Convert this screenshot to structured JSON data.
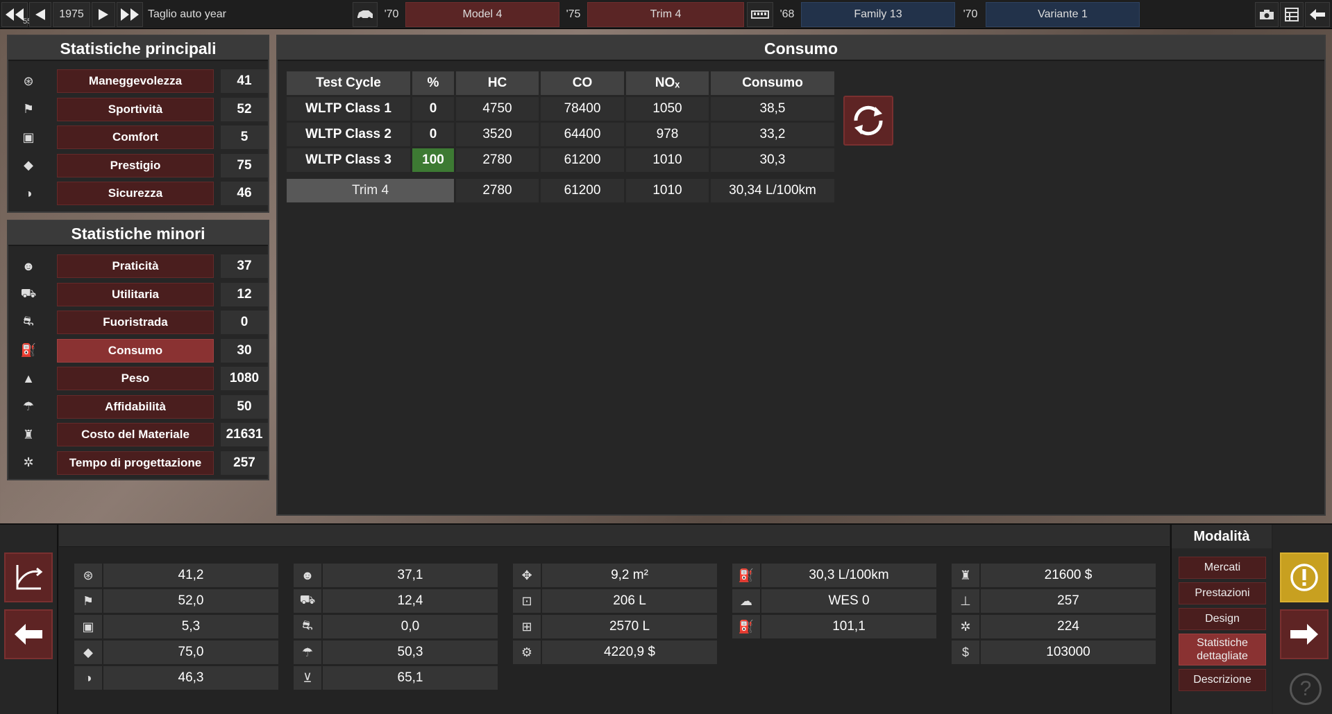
{
  "topbar": {
    "badge": "55",
    "year": "1975",
    "year_label": "Taglio auto year",
    "model_year": "'70",
    "model_name": "Model 4",
    "trim_year": "'75",
    "trim_name": "Trim 4",
    "engine_year": "'68",
    "family_name": "Family 13",
    "variant_year": "'70",
    "variant_name": "Variante 1"
  },
  "main_stats": {
    "title": "Statistiche principali",
    "items": [
      {
        "icon": "steering-wheel-icon",
        "label": "Maneggevolezza",
        "value": "41"
      },
      {
        "icon": "checkered-flag-icon",
        "label": "Sportività",
        "value": "52"
      },
      {
        "icon": "seat-icon",
        "label": "Comfort",
        "value": "5"
      },
      {
        "icon": "diamond-icon",
        "label": "Prestigio",
        "value": "75"
      },
      {
        "icon": "crash-test-icon",
        "label": "Sicurezza",
        "value": "46"
      }
    ]
  },
  "minor_stats": {
    "title": "Statistiche minori",
    "items": [
      {
        "icon": "passengers-icon",
        "label": "Praticità",
        "value": "37"
      },
      {
        "icon": "truck-icon",
        "label": "Utilitaria",
        "value": "12"
      },
      {
        "icon": "offroad-icon",
        "label": "Fuoristrada",
        "value": "0"
      },
      {
        "icon": "fuel-can-icon",
        "label": "Consumo",
        "value": "30"
      },
      {
        "icon": "weight-icon",
        "label": "Peso",
        "value": "1080"
      },
      {
        "icon": "reliability-icon",
        "label": "Affidabilità",
        "value": "50"
      },
      {
        "icon": "engineer-icon",
        "label": "Costo del Materiale",
        "value": "21631"
      },
      {
        "icon": "gears-icon",
        "label": "Tempo di progettazione",
        "value": "257"
      }
    ]
  },
  "consumo": {
    "title": "Consumo",
    "headers": [
      "Test Cycle",
      "%",
      "HC",
      "CO",
      "NOₓ",
      "Consumo"
    ],
    "rows": [
      {
        "cycle": "WLTP Class 1",
        "pct": "0",
        "hc": "4750",
        "co": "78400",
        "nox": "1050",
        "consumo": "38,5"
      },
      {
        "cycle": "WLTP Class 2",
        "pct": "0",
        "hc": "3520",
        "co": "64400",
        "nox": "978",
        "consumo": "33,2"
      },
      {
        "cycle": "WLTP Class 3",
        "pct": "100",
        "hc": "2780",
        "co": "61200",
        "nox": "1010",
        "consumo": "30,3"
      }
    ],
    "total": {
      "name": "Trim 4",
      "hc": "2780",
      "co": "61200",
      "nox": "1010",
      "consumo": "30,34 L/100km"
    },
    "highlight_color": "#3d7a33"
  },
  "bottom": {
    "col1": [
      {
        "icon": "steering-wheel-icon",
        "value": "41,2"
      },
      {
        "icon": "checkered-flag-icon",
        "value": "52,0"
      },
      {
        "icon": "seat-icon",
        "value": "5,3"
      },
      {
        "icon": "diamond-icon",
        "value": "75,0"
      },
      {
        "icon": "crash-test-icon",
        "value": "46,3"
      }
    ],
    "col2": [
      {
        "icon": "passengers-icon",
        "value": "37,1"
      },
      {
        "icon": "truck-icon",
        "value": "12,4"
      },
      {
        "icon": "offroad-icon",
        "value": "0,0"
      },
      {
        "icon": "reliability-icon",
        "value": "50,3"
      },
      {
        "icon": "weight-down-icon",
        "value": "65,1"
      }
    ],
    "col3": [
      {
        "icon": "area-arrows-icon",
        "value": "9,2 m²"
      },
      {
        "icon": "cargo-volume-icon",
        "value": "206 L"
      },
      {
        "icon": "passenger-volume-icon",
        "value": "2570 L"
      },
      {
        "icon": "service-cost-icon",
        "value": "4220,9 $"
      }
    ],
    "col4": [
      {
        "icon": "fuel-can-icon",
        "value": "30,3 L/100km"
      },
      {
        "icon": "emissions-cloud-icon",
        "value": "WES 0"
      },
      {
        "icon": "fuel-pump-icon",
        "value": "101,1"
      }
    ],
    "col5": [
      {
        "icon": "engineer-icon",
        "value": "21600 $"
      },
      {
        "icon": "anvil-icon",
        "value": "257"
      },
      {
        "icon": "gears-icon",
        "value": "224"
      },
      {
        "icon": "dollar-icon",
        "value": "103000"
      }
    ]
  },
  "modalita": {
    "title": "Modalità",
    "items": [
      "Mercati",
      "Prestazioni",
      "Design",
      "Statistiche dettagliate",
      "Descrizione"
    ],
    "active": "Statistiche dettagliate"
  },
  "colors": {
    "accent_red": "#4a1e1e",
    "active_red": "#8a3232",
    "blue": "#22324a",
    "warning_yellow": "#c8a020"
  }
}
